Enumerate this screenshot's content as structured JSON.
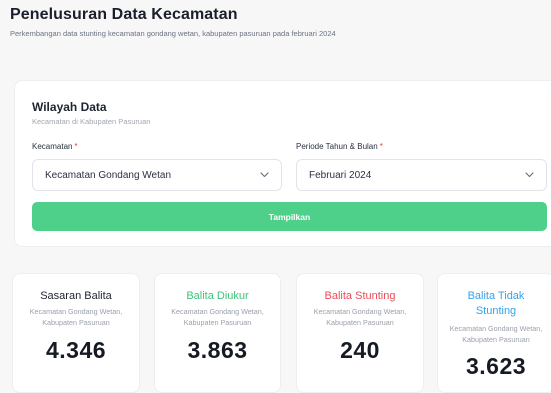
{
  "header": {
    "title": "Penelusuran Data Kecamatan",
    "subtitle": "Perkembangan data stunting kecamatan gondang wetan, kabupaten pasuruan pada februari 2024"
  },
  "filter": {
    "title": "Wilayah Data",
    "subtitle": "Kecamatan di Kabupaten Pasuruan",
    "kecamatan_label": "Kecamatan",
    "kecamatan_value": "Kecamatan Gondang Wetan",
    "periode_label": "Periode Tahun & Bulan",
    "periode_value": "Februari 2024",
    "required_mark": "*",
    "dropdown_icon": "chevron-down-icon",
    "submit_label": "Tampilkan",
    "submit_color": "#4fd08a"
  },
  "stats": [
    {
      "title": "Sasaran Balita",
      "desc": "Kecamatan Gondang Wetan, Kabupaten Pasuruan",
      "value": "4.346",
      "color": "#1f2430"
    },
    {
      "title": "Balita Diukur",
      "desc": "Kecamatan Gondang Wetan, Kabupaten Pasuruan",
      "value": "3.863",
      "color": "#3ec27a"
    },
    {
      "title": "Balita Stunting",
      "desc": "Kecamatan Gondang Wetan, Kabupaten Pasuruan",
      "value": "240",
      "color": "#ef4b5a"
    },
    {
      "title": "Balita Tidak Stunting",
      "desc": "Kecamatan Gondang Wetan, Kabupaten Pasuruan",
      "value": "3.623",
      "color": "#36a3e8"
    }
  ]
}
